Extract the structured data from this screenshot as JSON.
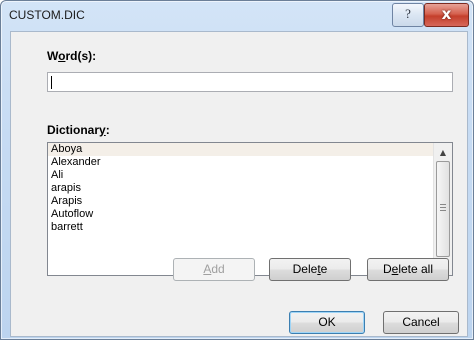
{
  "window": {
    "title": "CUSTOM.DIC",
    "help_glyph": "?",
    "close_glyph": "x"
  },
  "form": {
    "word_label_pre": "W",
    "word_label_ul": "o",
    "word_label_post": "rd(s):",
    "word_value": "",
    "dictionary_label_pre": "Dictionar",
    "dictionary_label_ul": "y",
    "dictionary_label_post": ":"
  },
  "dictionary": {
    "items": [
      "Aboya",
      "Alexander",
      "Ali",
      "arapis",
      "Arapis",
      "Autoflow",
      "barrett"
    ],
    "selected_index": 0
  },
  "buttons": {
    "add_ul": "A",
    "add_rest": "dd",
    "delete_pre": "Dele",
    "delete_ul": "t",
    "delete_post": "e",
    "delete_all_pre": "D",
    "delete_all_ul": "e",
    "delete_all_post": "lete all",
    "ok": "OK",
    "cancel": "Cancel"
  },
  "icons": {
    "scroll_up": "▲",
    "scroll_down": "▼"
  }
}
